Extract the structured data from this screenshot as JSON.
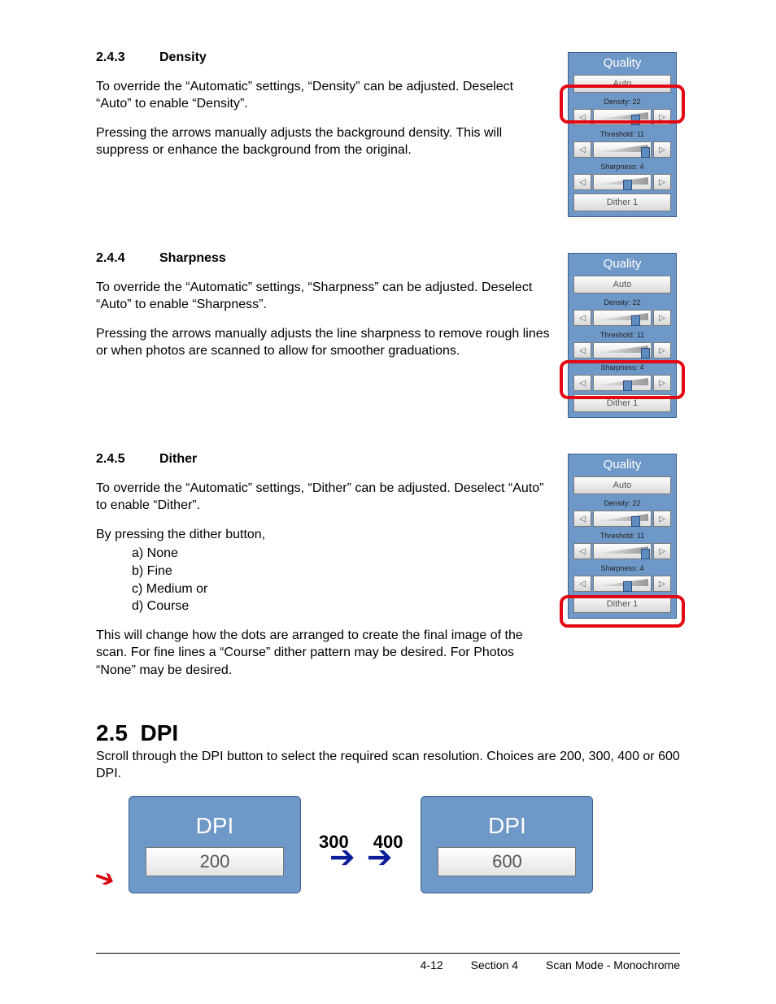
{
  "sections": {
    "density": {
      "num": "2.4.3",
      "title": "Density",
      "p1": "To override the “Automatic” settings, “Density” can be adjusted. Deselect “Auto” to enable “Density”.",
      "p2": "Pressing the arrows manually adjusts the background density. This will suppress or enhance the background from the original."
    },
    "sharpness": {
      "num": "2.4.4",
      "title": "Sharpness",
      "p1": "To override the “Automatic” settings, “Sharpness” can be adjusted. Deselect “Auto” to enable “Sharpness”.",
      "p2": "Pressing the arrows manually adjusts the line sharpness to remove rough lines or when photos are scanned to allow for smoother graduations."
    },
    "dither": {
      "num": "2.4.5",
      "title": "Dither",
      "p1": "To override the “Automatic” settings, “Dither” can be adjusted. Deselect “Auto” to enable “Dither”.",
      "p2": "By pressing the dither button,",
      "opts": {
        "a": "a)  None",
        "b": "b)  Fine",
        "c": "c)  Medium or",
        "d": "d)  Course"
      },
      "p3": "This will change how the dots are arranged to create the final image of the scan. For fine lines a “Course” dither pattern may be desired. For Photos “None” may be desired."
    },
    "dpi": {
      "num": "2.5",
      "title": "DPI",
      "p1": "Scroll through the DPI button to select the required scan resolution. Choices are 200, 300, 400 or 600 DPI.",
      "mid1": "300",
      "mid2": "400"
    }
  },
  "panel": {
    "title": "Quality",
    "auto": "Auto",
    "density_label": "Density: 22",
    "threshold_label": "Threshold: 11",
    "sharpness_label": "Sharpness: 4",
    "dither_btn": "Dither 1"
  },
  "dpi": {
    "title": "DPI",
    "v1": "200",
    "v2": "600"
  },
  "arrows": {
    "left": "◁",
    "right": "▷",
    "big": "➡"
  },
  "footer": {
    "pg": "4-12",
    "sec": "Section 4",
    "name": "Scan Mode - Monochrome"
  }
}
